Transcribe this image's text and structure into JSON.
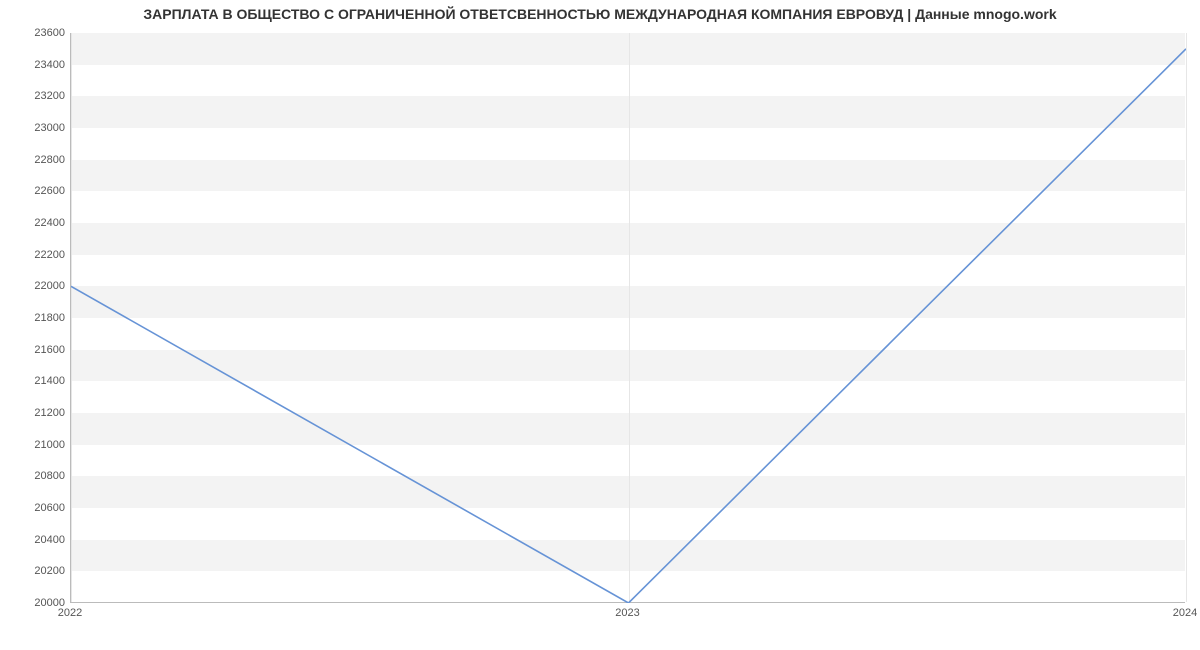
{
  "chart_data": {
    "type": "line",
    "title": "ЗАРПЛАТА В ОБЩЕСТВО С ОГРАНИЧЕННОЙ ОТВЕТСВЕННОСТЬЮ МЕЖДУНАРОДНАЯ КОМПАНИЯ ЕВРОВУД | Данные mnogo.work",
    "x": [
      "2022",
      "2023",
      "2024"
    ],
    "values": [
      22000,
      20000,
      23500
    ],
    "xlabel": "",
    "ylabel": "",
    "ylim": [
      20000,
      23600
    ],
    "y_ticks": [
      20000,
      20200,
      20400,
      20600,
      20800,
      21000,
      21200,
      21400,
      21600,
      21800,
      22000,
      22200,
      22400,
      22600,
      22800,
      23000,
      23200,
      23400,
      23600
    ],
    "line_color": "#6693d6"
  }
}
